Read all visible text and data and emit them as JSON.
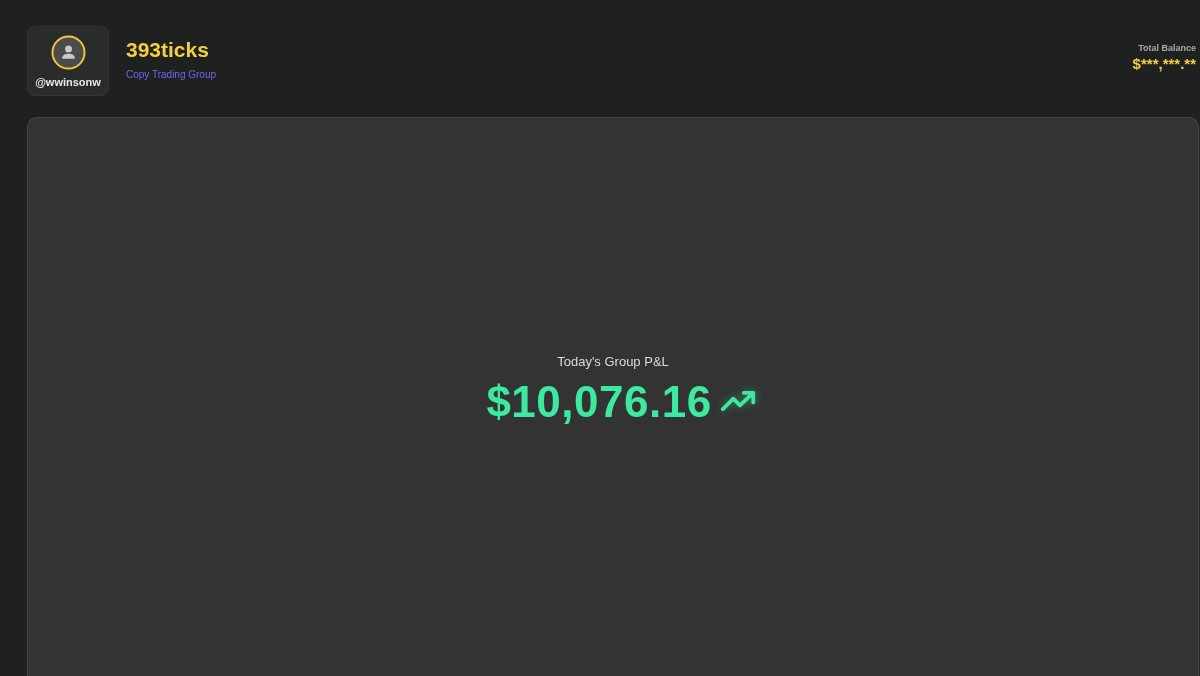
{
  "profile": {
    "username": "@wwinsonw"
  },
  "group": {
    "name": "393ticks",
    "subtitle": "Copy Trading Group"
  },
  "balance": {
    "label": "Total Balance",
    "value": "$***,***.**"
  },
  "pnl": {
    "label": "Today's Group P&L",
    "value": "$10,076.16",
    "rising": true
  }
}
